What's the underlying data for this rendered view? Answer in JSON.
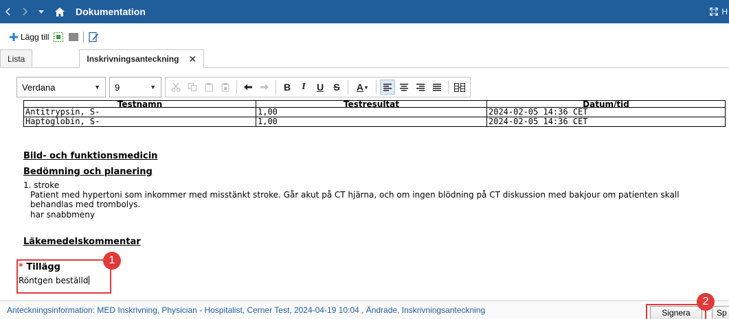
{
  "titlebar": {
    "title": "Dokumentation",
    "right_text": "H",
    "bg_color": "#1f5d9b"
  },
  "actions": {
    "add_label": "Lägg till"
  },
  "tabs": [
    {
      "label": "Lista",
      "active": false
    },
    {
      "label": "Inskrivningsanteckning",
      "active": true,
      "close": "✕"
    }
  ],
  "toolbar": {
    "font": "Verdana",
    "size": "9",
    "buttons": [
      "cut-icon",
      "copy-icon",
      "paste-icon",
      "paste-special-icon",
      "undo-icon",
      "redo-icon",
      "bold",
      "italic",
      "underline",
      "strikethrough",
      "font-color",
      "align-left-icon",
      "align-center-icon",
      "align-right-icon",
      "justify-icon",
      "table-icon"
    ]
  },
  "results_table": {
    "headers": [
      "Testnamn",
      "Testresultat",
      "Datum/tid"
    ],
    "rows": [
      [
        "Antitrypsin, S-",
        "1,00",
        "2024-02-05 14:36 CET"
      ],
      [
        "Haptoglobin, S-",
        "1,00",
        "2024-02-05 14:36 CET"
      ]
    ]
  },
  "sections": {
    "bild": "Bild- och funktionsmedicin",
    "bedomning": "Bedömning och planering",
    "item_1": "1. stroke",
    "para_1": "Patient med hypertoni som inkommer med misstänkt stroke. Går akut på CT hjärna, och om ingen blödning på CT diskussion med bakjour om patienten skall behandlas med trombolys.",
    "para_2": "har snabbmeny",
    "lakemedel": "Läkemedelskommentar",
    "tillagg_star": "*",
    "tillagg": "Tillägg",
    "tillagg_text": "Röntgen beställd"
  },
  "annotations": {
    "badge_1": "1",
    "badge_2": "2",
    "color": "#e03a3a"
  },
  "footer": {
    "info": "Anteckningsinformation: MED Inskrivning, Physician - Hospitalist, Cerner Test, 2024-04-19 10:04 , Ändrade, Inskrivningsanteckning",
    "sign_label": "Signera",
    "next_label": "Sp"
  }
}
